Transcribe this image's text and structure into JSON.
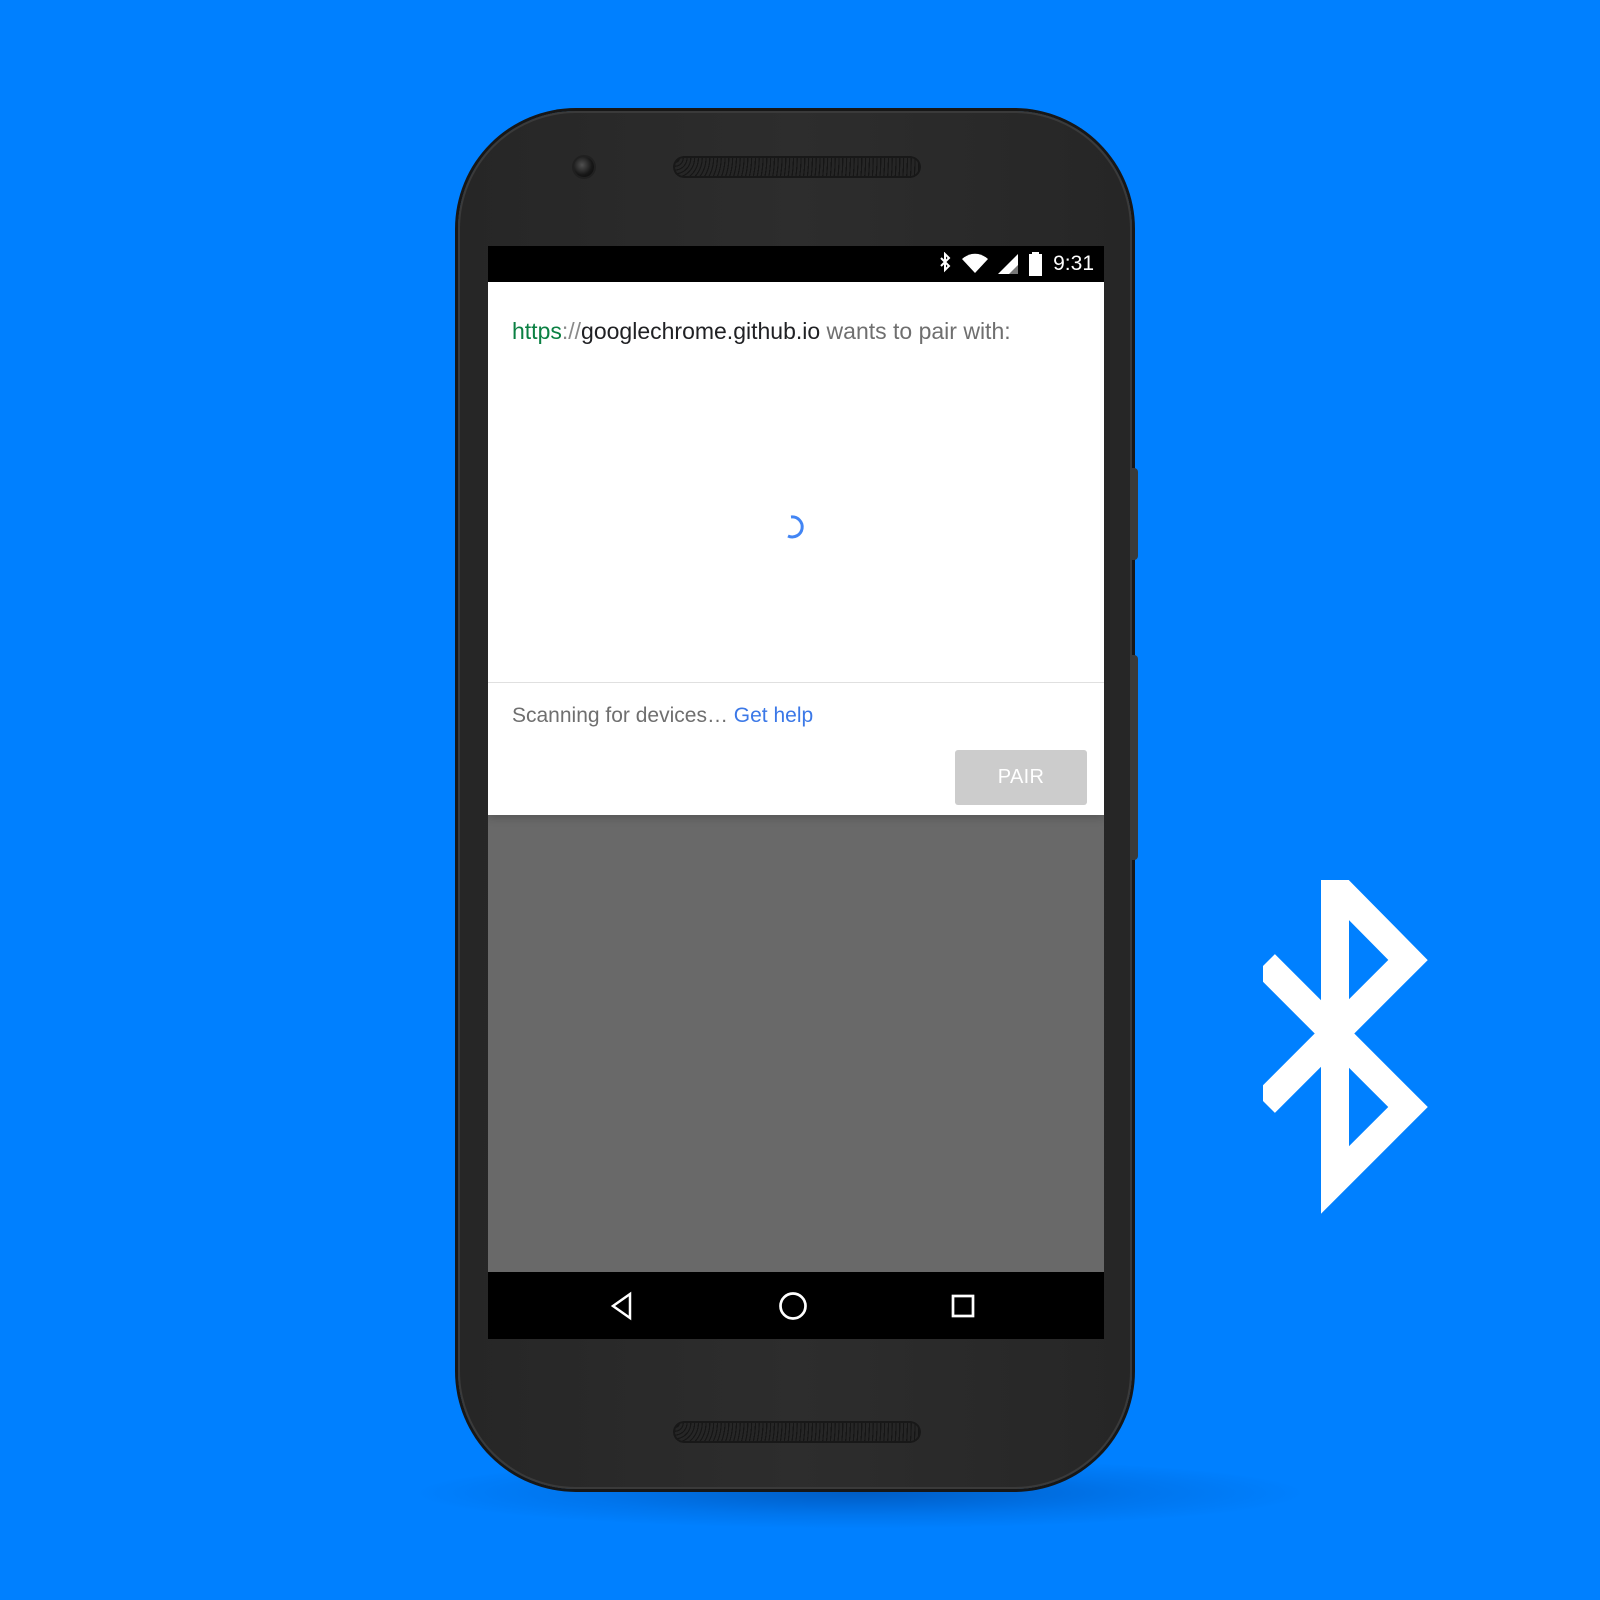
{
  "background": {
    "color": "#0080ff"
  },
  "phone": {
    "body_color": "#2b2b2b",
    "status_bar": {
      "time": "9:31",
      "icons": [
        "bluetooth-icon",
        "wifi-icon",
        "cellular-signal-icon",
        "battery-icon"
      ]
    },
    "dialog": {
      "url_scheme": "https",
      "url_separator": "://",
      "url_host": "googlechrome.github.io",
      "prompt_suffix": " wants to pair with:",
      "status_text": "Scanning for devices… ",
      "help_link": "Get help",
      "pair_button": "PAIR",
      "loading": true
    },
    "navigation": {
      "buttons": [
        "back-icon",
        "home-icon",
        "recents-icon"
      ]
    }
  },
  "decoration": {
    "icon": "bluetooth-logo",
    "color": "#ffffff"
  }
}
